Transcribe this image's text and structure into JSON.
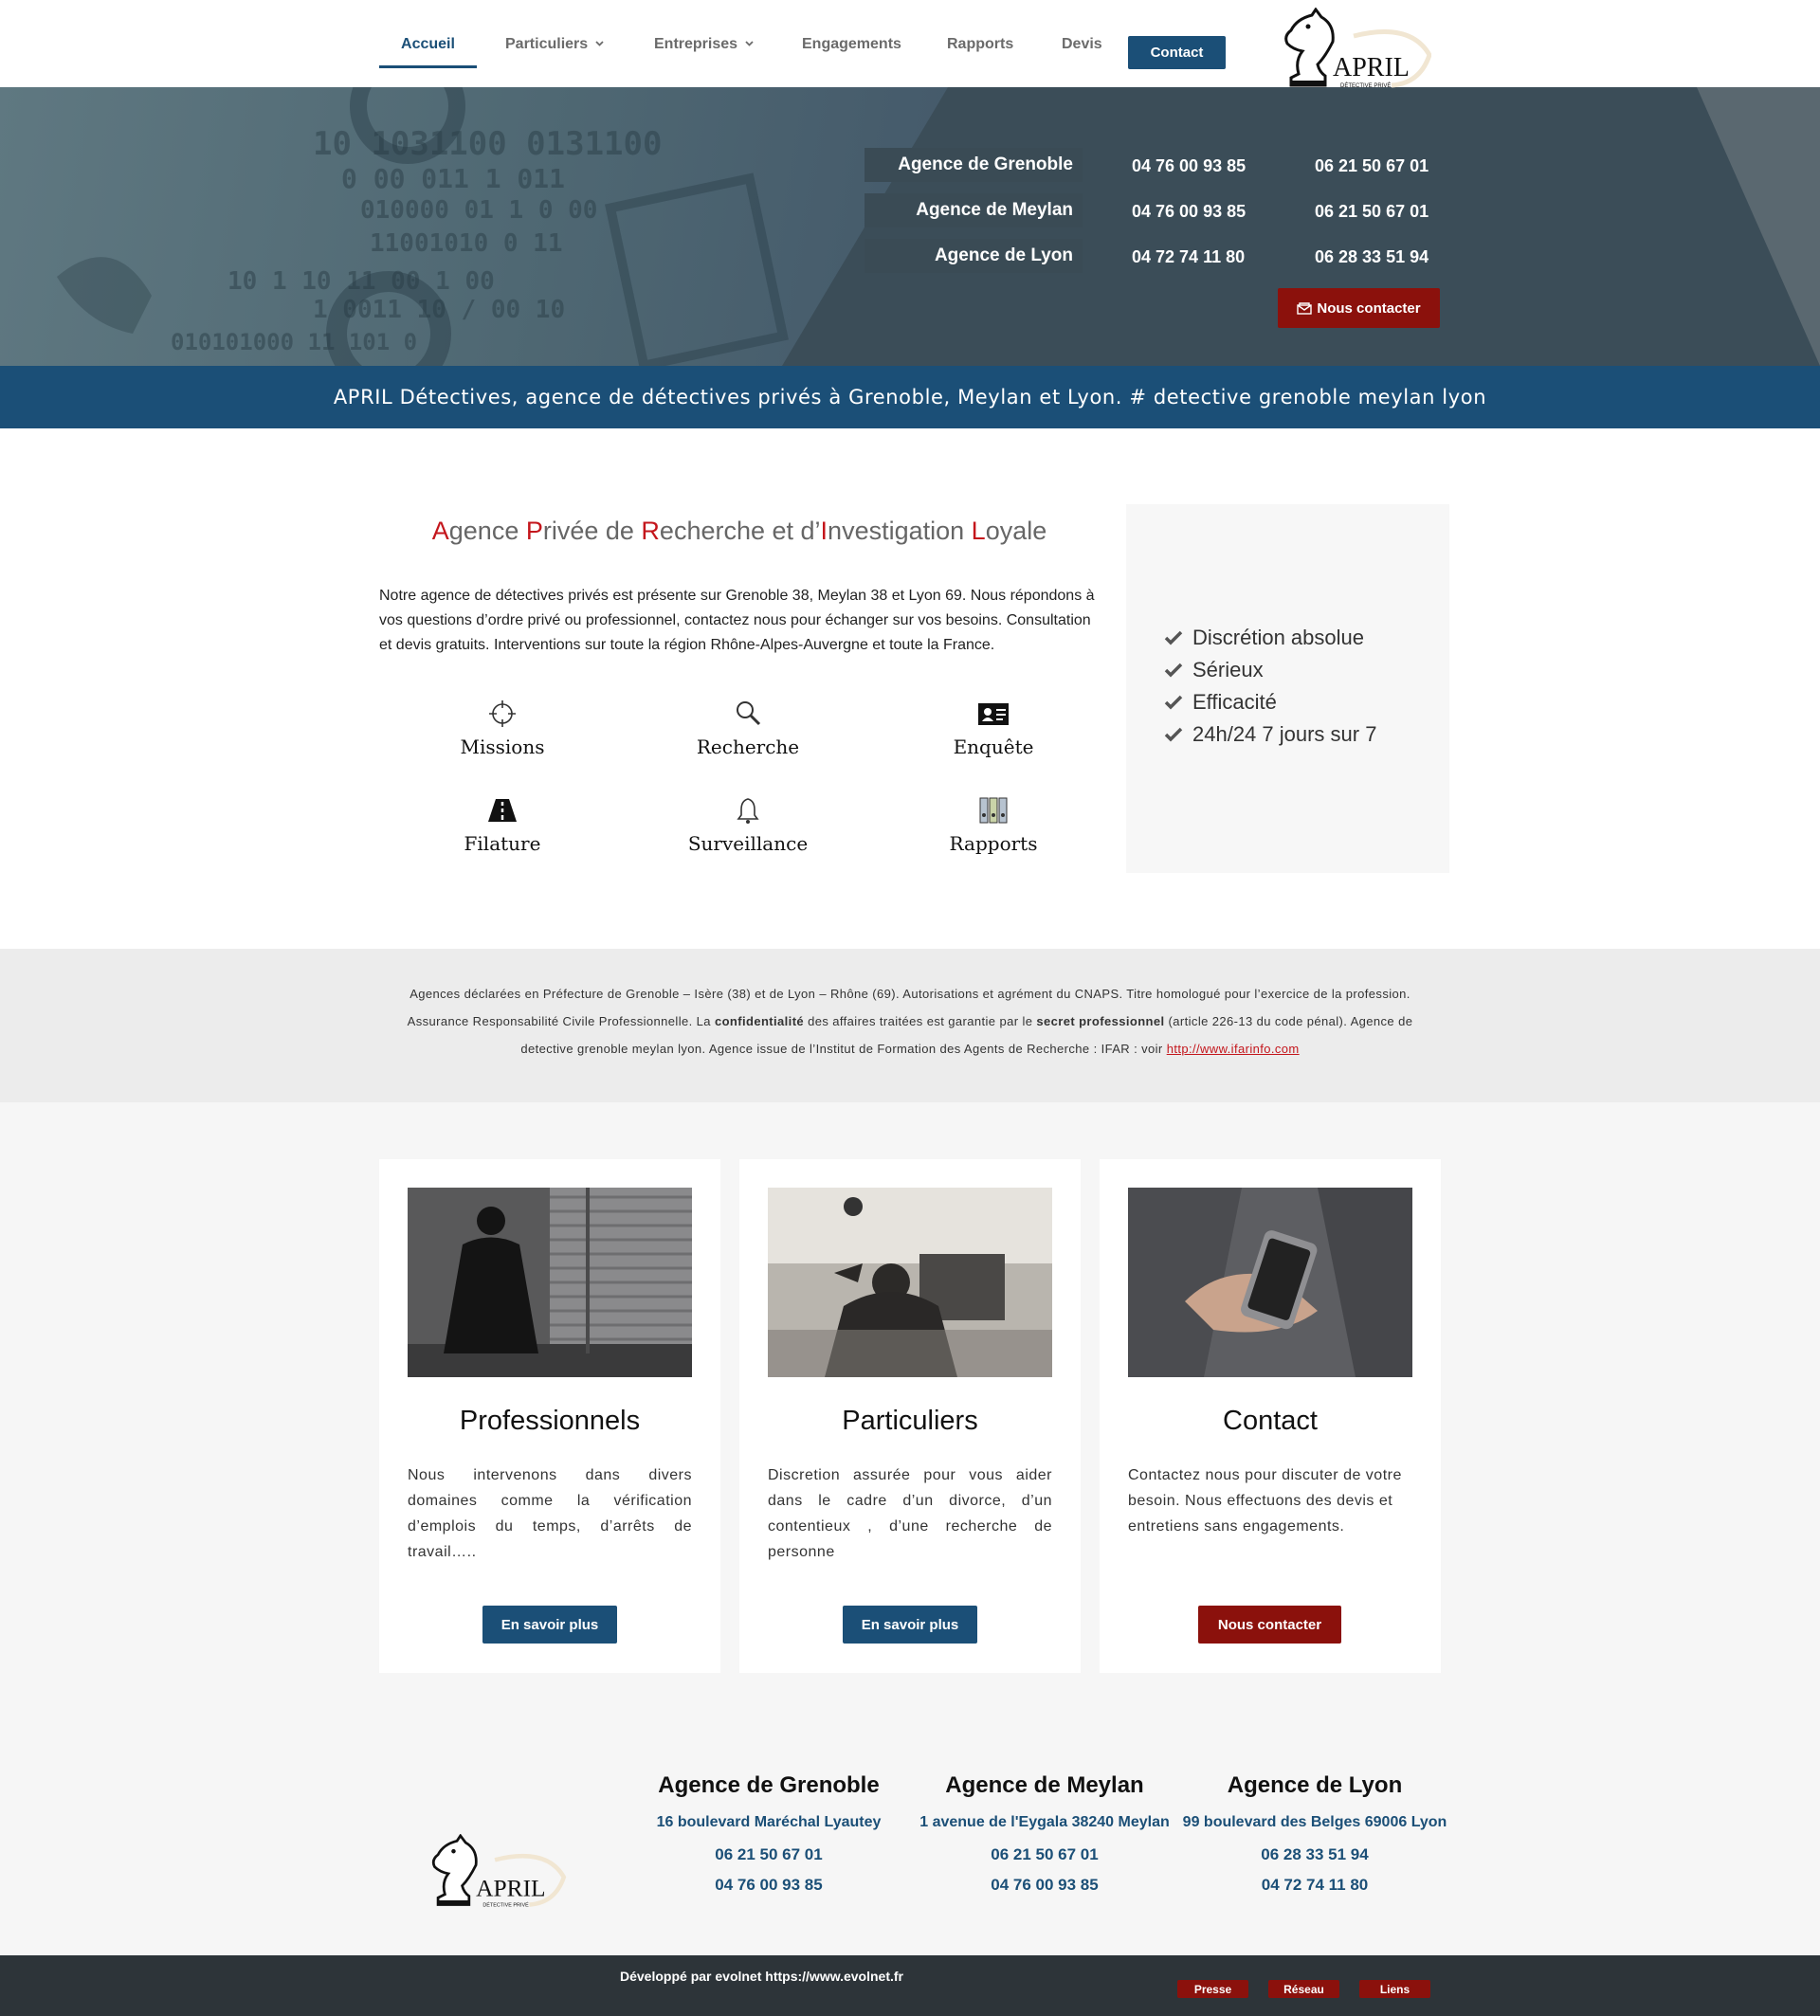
{
  "nav": {
    "items": [
      {
        "label": "Accueil",
        "active": true
      },
      {
        "label": "Particuliers",
        "has_caret": true
      },
      {
        "label": "Entreprises",
        "has_caret": true
      },
      {
        "label": "Engagements"
      },
      {
        "label": "Rapports"
      },
      {
        "label": "Devis"
      }
    ],
    "contact_label": "Contact",
    "logo_text": "APRIL",
    "logo_sub": "DÉTECTIVE PRIVÉ"
  },
  "hero": {
    "agencies": [
      {
        "name": "Agence de Grenoble",
        "phone1": "04 76 00 93 85",
        "phone2": "06 21 50 67 01"
      },
      {
        "name": "Agence de Meylan",
        "phone1": "04 76 00 93 85",
        "phone2": "06 21 50 67 01"
      },
      {
        "name": "Agence de Lyon",
        "phone1": "04 72 74 11 80",
        "phone2": "06 28 33 51 94"
      }
    ],
    "button_label": "Nous contacter",
    "binary_lines": [
      "10  1031100  0131100",
      "0  00 011 1  011",
      "010000 01 1  0 00",
      "  11001010  0 11",
      "10  1 10 11 00 1 00",
      "1 0011 10 / 00 10",
      "010101000  11 101 0"
    ]
  },
  "band": {
    "text": "APRIL Détectives, agence de détectives privés à Grenoble, Meylan et Lyon. # detective grenoble meylan lyon"
  },
  "intro": {
    "title_parts": [
      {
        "t": "A",
        "red": true
      },
      {
        "t": "gence ",
        "red": false
      },
      {
        "t": "P",
        "red": true
      },
      {
        "t": "rivée de ",
        "red": false
      },
      {
        "t": "R",
        "red": true
      },
      {
        "t": "echerche et d’",
        "red": false
      },
      {
        "t": "I",
        "red": true
      },
      {
        "t": "nvestigation ",
        "red": false
      },
      {
        "t": "L",
        "red": true
      },
      {
        "t": "oyale",
        "red": false
      }
    ],
    "text": "Notre agence de détectives privés est présente sur Grenoble 38, Meylan 38 et Lyon 69. Nous répondons à vos questions d’ordre privé ou professionnel, contactez nous pour échanger sur vos besoins. Consultation et devis gratuits. Interventions sur toute la région Rhône-Alpes-Auvergne et toute la France."
  },
  "services": [
    {
      "label": "Missions",
      "icon": "crosshair-icon"
    },
    {
      "label": "Recherche",
      "icon": "magnifier-icon"
    },
    {
      "label": "Enquête",
      "icon": "id-card-icon"
    },
    {
      "label": "Filature",
      "icon": "road-icon"
    },
    {
      "label": "Surveillance",
      "icon": "bell-icon"
    },
    {
      "label": "Rapports",
      "icon": "binders-icon"
    }
  ],
  "features": [
    "Discrétion absolue",
    "Sérieux",
    "Efficacité",
    "24h/24 7 jours sur 7"
  ],
  "legal": {
    "line1": "Agences déclarées en Préfecture de Grenoble – Isère (38) et de Lyon – Rhône (69). Autorisations et agrément du CNAPS. Titre homologué pour l’exercice de la profession.",
    "line2_a": "Assurance Responsabilité Civile Professionnelle.  La ",
    "line2_b": "confidentialité",
    "line2_c": " des affaires traitées est garantie par le ",
    "line2_d": "secret professionnel",
    "line2_e": " (article 226-13 du code pénal). Agence de",
    "line3": "detective grenoble meylan lyon. Agence issue de l’Institut de Formation des Agents de Recherche : IFAR : voir ",
    "link": "http://www.ifarinfo.com"
  },
  "cards": [
    {
      "title": "Professionnels",
      "text": "Nous intervenons dans divers domaines comme la vérification d’emplois du temps, d’arrêts de travail…..",
      "button": "En savoir plus",
      "button_color": "#1b4f77"
    },
    {
      "title": "Particuliers",
      "text": "Discretion assurée pour vous aider dans le cadre d’un divorce, d’un contentieux , d’une recherche de personne",
      "button": "En savoir plus",
      "button_color": "#1b4f77"
    },
    {
      "title": "Contact",
      "text": "Contactez nous pour discuter de votre besoin. Nous effectuons des devis et entretiens  sans engagements.",
      "button": "Nous contacter",
      "button_color": "#8b110c"
    }
  ],
  "footer": {
    "agencies": [
      {
        "title": "Agence de Grenoble",
        "address": "16 boulevard Maréchal Lyautey",
        "phone1": "06 21 50 67 01",
        "phone2": "04 76 00 93 85"
      },
      {
        "title": "Agence de Meylan",
        "address": "1 avenue de l'Eygala 38240 Meylan",
        "phone1": "06 21 50 67 01",
        "phone2": "04 76 00 93 85"
      },
      {
        "title": "Agence de Lyon",
        "address": "99 boulevard des Belges 69006 Lyon",
        "phone1": "06 28 33 51 94",
        "phone2": "04 72 74 11 80"
      }
    ],
    "dev_text": "Développé par evolnet https://www.evolnet.fr",
    "links": [
      "Presse",
      "Réseau",
      "Liens"
    ]
  },
  "colors": {
    "primary": "#1b4f77",
    "accent": "#8b110c",
    "title_red": "#c4161c",
    "dark_footer": "#2d3439"
  }
}
